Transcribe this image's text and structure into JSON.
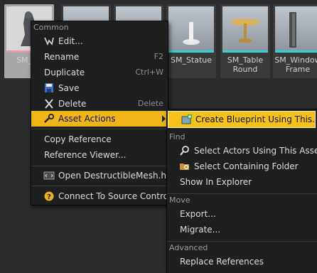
{
  "assets": [
    {
      "label": "SM_Ro",
      "selected": true
    },
    {
      "label": ""
    },
    {
      "label": ""
    },
    {
      "label": ""
    },
    {
      "label": "SM_Statue"
    },
    {
      "label": "SM_Table Round"
    },
    {
      "label": "SM_Window Frame"
    }
  ],
  "menu": {
    "common_header": "Common",
    "edit": "Edit...",
    "rename": "Rename",
    "rename_key": "F2",
    "duplicate": "Duplicate",
    "duplicate_key": "Ctrl+W",
    "save": "Save",
    "delete": "Delete",
    "delete_key": "Delete",
    "asset_actions": "Asset Actions",
    "copy_reference": "Copy Reference",
    "reference_viewer": "Reference Viewer...",
    "open_file": "Open DestructibleMesh.h",
    "connect": "Connect To Source Control"
  },
  "submenu": {
    "create_blueprint": "Create Blueprint Using This...",
    "find_header": "Find",
    "select_actors": "Select Actors Using This Asset",
    "select_folder": "Select Containing Folder",
    "show_explorer": "Show In Explorer",
    "move_header": "Move",
    "export": "Export...",
    "migrate": "Migrate...",
    "advanced_header": "Advanced",
    "replace_refs": "Replace References"
  },
  "colors": {
    "highlight": "#f0b519",
    "menu_bg": "#1f1f1f",
    "accent_cyan": "#35d0d8"
  }
}
